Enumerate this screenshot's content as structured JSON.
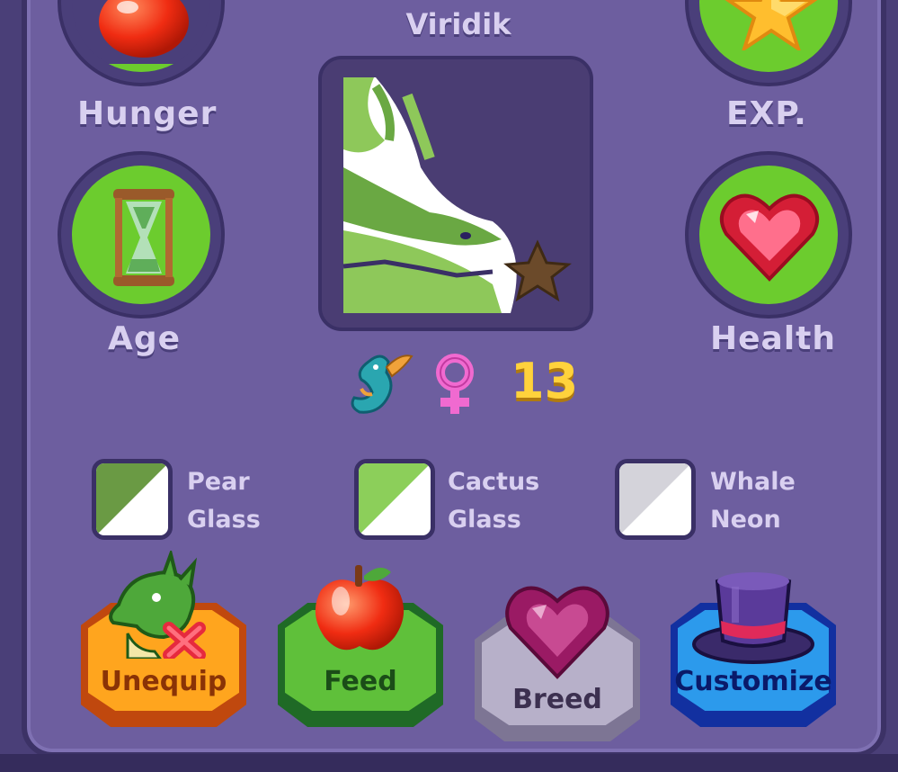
{
  "pet": {
    "name": "Viridik",
    "level": "13"
  },
  "stats": {
    "hunger": {
      "label": "Hunger",
      "icon": "apple-icon",
      "fill": 0.06
    },
    "exp": {
      "label": "EXP.",
      "icon": "star-icon",
      "fill": 1.0
    },
    "age": {
      "label": "Age",
      "icon": "hourglass-icon",
      "fill": 1.0
    },
    "health": {
      "label": "Health",
      "icon": "heart-icon",
      "fill": 1.0
    }
  },
  "tags": {
    "species_icon": "dragon-icon",
    "gender_icon": "female-icon"
  },
  "colors": {
    "primary": {
      "line1": "Pear",
      "line2": "Glass",
      "hex": "#6a9a44"
    },
    "secondary": {
      "line1": "Cactus",
      "line2": "Glass",
      "hex": "#8ccf5a"
    },
    "tertiary": {
      "line1": "Whale",
      "line2": "Neon",
      "hex": "#d4d3da"
    }
  },
  "actions": {
    "unequip": "Unequip",
    "feed": "Feed",
    "breed": "Breed",
    "customize": "Customize"
  }
}
